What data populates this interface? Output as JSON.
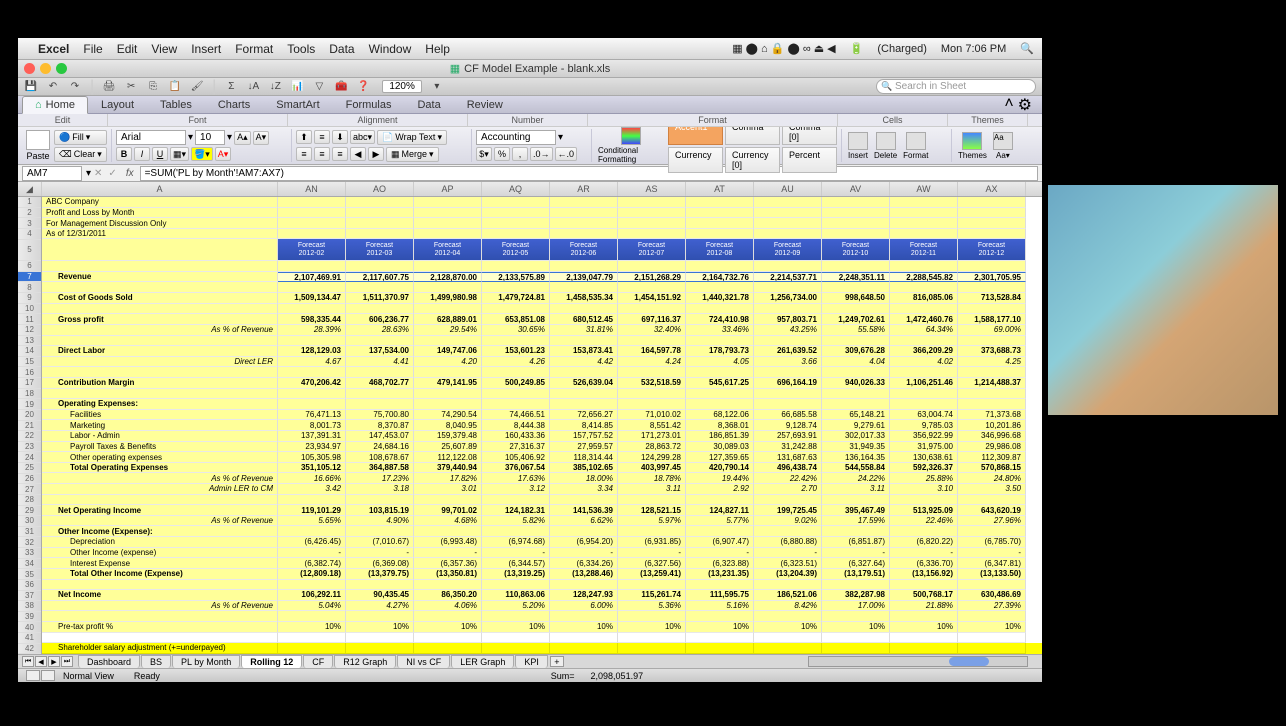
{
  "menubar": {
    "app": "Excel",
    "items": [
      "File",
      "Edit",
      "View",
      "Insert",
      "Format",
      "Tools",
      "Data",
      "Window",
      "Help"
    ],
    "battery": "(Charged)",
    "clock": "Mon 7:06 PM"
  },
  "window": {
    "title": "CF Model Example - blank.xls"
  },
  "qat": {
    "zoom": "120%",
    "search_placeholder": "Search in Sheet"
  },
  "ribbon": {
    "tabs": [
      "Home",
      "Layout",
      "Tables",
      "Charts",
      "SmartArt",
      "Formulas",
      "Data",
      "Review"
    ],
    "groups": {
      "edit": "Edit",
      "font": "Font",
      "align": "Alignment",
      "number": "Number",
      "format": "Format",
      "cells": "Cells",
      "themes": "Themes"
    },
    "fill": "Fill",
    "clear": "Clear",
    "paste": "Paste",
    "font_name": "Arial",
    "font_size": "10",
    "wrap": "Wrap Text",
    "merge": "Merge",
    "num_format": "Accounting",
    "cond_fmt": "Conditional Formatting",
    "styles": {
      "accent": "Accent1",
      "comma": "Comma",
      "comma0": "Comma [0]",
      "currency": "Currency",
      "currency0": "Currency [0]",
      "percent": "Percent"
    },
    "insert": "Insert",
    "delete": "Delete",
    "format_btn": "Format",
    "themes_btn": "Themes"
  },
  "formula": {
    "name_box": "AM7",
    "formula": "=SUM('PL by Month'!AM7:AX7)"
  },
  "columns": [
    "A",
    "AN",
    "AO",
    "AP",
    "AQ",
    "AR",
    "AS",
    "AT",
    "AU",
    "AV",
    "AW",
    "AX"
  ],
  "header_top": "Forecast",
  "header_dates": [
    "2012-02",
    "2012-03",
    "2012-04",
    "2012-05",
    "2012-06",
    "2012-07",
    "2012-08",
    "2012-09",
    "2012-10",
    "2012-11",
    "2012-12"
  ],
  "row_labels": {
    "1": "ABC Company",
    "2": "Profit and Loss by Month",
    "3": "For Management Discussion Only",
    "4": "As of 12/31/2011",
    "7": "Revenue",
    "9": "Cost of Goods Sold",
    "11": "Gross profit",
    "12": "As % of Revenue",
    "14": "Direct Labor",
    "15": "Direct LER",
    "17": "Contribution Margin",
    "19": "Operating Expenses:",
    "20": "Facilities",
    "21": "Marketing",
    "22": "Labor - Admin",
    "23": "Payroll Taxes & Benefits",
    "24": "Other operating expenses",
    "25": "Total Operating Expenses",
    "26": "As % of Revenue",
    "27": "Admin LER to CM",
    "29": "Net Operating Income",
    "30": "As % of Revenue",
    "31": "Other Income (Expense):",
    "32": "Depreciation",
    "33": "Other Income (expense)",
    "34": "Interest Expense",
    "35": "Total Other Income (Expense)",
    "37": "Net Income",
    "38": "As % of Revenue",
    "40": "Pre-tax profit %",
    "42": "Shareholder salary adjustment (+=underpayed)"
  },
  "chart_data": {
    "type": "table",
    "rows": {
      "7": [
        "2,107,469.91",
        "2,117,607.75",
        "2,128,870.00",
        "2,133,575.89",
        "2,139,047.79",
        "2,151,268.29",
        "2,164,732.76",
        "2,214,537.71",
        "2,248,351.11",
        "2,288,545.82",
        "2,301,705.95"
      ],
      "9": [
        "1,509,134.47",
        "1,511,370.97",
        "1,499,980.98",
        "1,479,724.81",
        "1,458,535.34",
        "1,454,151.92",
        "1,440,321.78",
        "1,256,734.00",
        "998,648.50",
        "816,085.06",
        "713,528.84"
      ],
      "11": [
        "598,335.44",
        "606,236.77",
        "628,889.01",
        "653,851.08",
        "680,512.45",
        "697,116.37",
        "724,410.98",
        "957,803.71",
        "1,249,702.61",
        "1,472,460.76",
        "1,588,177.10"
      ],
      "12": [
        "28.39%",
        "28.63%",
        "29.54%",
        "30.65%",
        "31.81%",
        "32.40%",
        "33.46%",
        "43.25%",
        "55.58%",
        "64.34%",
        "69.00%"
      ],
      "14": [
        "128,129.03",
        "137,534.00",
        "149,747.06",
        "153,601.23",
        "153,873.41",
        "164,597.78",
        "178,793.73",
        "261,639.52",
        "309,676.28",
        "366,209.29",
        "373,688.73"
      ],
      "15": [
        "4.67",
        "4.41",
        "4.20",
        "4.26",
        "4.42",
        "4.24",
        "4.05",
        "3.66",
        "4.04",
        "4.02",
        "4.25"
      ],
      "17": [
        "470,206.42",
        "468,702.77",
        "479,141.95",
        "500,249.85",
        "526,639.04",
        "532,518.59",
        "545,617.25",
        "696,164.19",
        "940,026.33",
        "1,106,251.46",
        "1,214,488.37"
      ],
      "20": [
        "76,471.13",
        "75,700.80",
        "74,290.54",
        "74,466.51",
        "72,656.27",
        "71,010.02",
        "68,122.06",
        "66,685.58",
        "65,148.21",
        "63,004.74",
        "71,373.68"
      ],
      "21": [
        "8,001.73",
        "8,370.87",
        "8,040.95",
        "8,444.38",
        "8,414.85",
        "8,551.42",
        "8,368.01",
        "9,128.74",
        "9,279.61",
        "9,785.03",
        "10,201.86"
      ],
      "22": [
        "137,391.31",
        "147,453.07",
        "159,379.48",
        "160,433.36",
        "157,757.52",
        "171,273.01",
        "186,851.39",
        "257,693.91",
        "302,017.33",
        "356,922.99",
        "346,996.68"
      ],
      "23": [
        "23,934.97",
        "24,684.16",
        "25,607.89",
        "27,316.37",
        "27,959.57",
        "28,863.72",
        "30,089.03",
        "31,242.88",
        "31,949.35",
        "31,975.00",
        "29,986.08"
      ],
      "24": [
        "105,305.98",
        "108,678.67",
        "112,122.08",
        "105,406.92",
        "118,314.44",
        "124,299.28",
        "127,359.65",
        "131,687.63",
        "136,164.35",
        "130,638.61",
        "112,309.87"
      ],
      "25": [
        "351,105.12",
        "364,887.58",
        "379,440.94",
        "376,067.54",
        "385,102.65",
        "403,997.45",
        "420,790.14",
        "496,438.74",
        "544,558.84",
        "592,326.37",
        "570,868.15"
      ],
      "26": [
        "16.66%",
        "17.23%",
        "17.82%",
        "17.63%",
        "18.00%",
        "18.78%",
        "19.44%",
        "22.42%",
        "24.22%",
        "25.88%",
        "24.80%"
      ],
      "27": [
        "3.42",
        "3.18",
        "3.01",
        "3.12",
        "3.34",
        "3.11",
        "2.92",
        "2.70",
        "3.11",
        "3.10",
        "3.50"
      ],
      "29": [
        "119,101.29",
        "103,815.19",
        "99,701.02",
        "124,182.31",
        "141,536.39",
        "128,521.15",
        "124,827.11",
        "199,725.45",
        "395,467.49",
        "513,925.09",
        "643,620.19"
      ],
      "30": [
        "5.65%",
        "4.90%",
        "4.68%",
        "5.82%",
        "6.62%",
        "5.97%",
        "5.77%",
        "9.02%",
        "17.59%",
        "22.46%",
        "27.96%"
      ],
      "32": [
        "(6,426.45)",
        "(7,010.67)",
        "(6,993.48)",
        "(6,974.68)",
        "(6,954.20)",
        "(6,931.85)",
        "(6,907.47)",
        "(6,880.88)",
        "(6,851.87)",
        "(6,820.22)",
        "(6,785.70)"
      ],
      "33": [
        "-",
        "-",
        "-",
        "-",
        "-",
        "-",
        "-",
        "-",
        "-",
        "-",
        "-"
      ],
      "34": [
        "(6,382.74)",
        "(6,369.08)",
        "(6,357.36)",
        "(6,344.57)",
        "(6,334.26)",
        "(6,327.56)",
        "(6,323.88)",
        "(6,323.51)",
        "(6,327.64)",
        "(6,336.70)",
        "(6,347.81)"
      ],
      "35": [
        "(12,809.18)",
        "(13,379.75)",
        "(13,350.81)",
        "(13,319.25)",
        "(13,288.46)",
        "(13,259.41)",
        "(13,231.35)",
        "(13,204.39)",
        "(13,179.51)",
        "(13,156.92)",
        "(13,133.50)"
      ],
      "37": [
        "106,292.11",
        "90,435.45",
        "86,350.20",
        "110,863.06",
        "128,247.93",
        "115,261.74",
        "111,595.75",
        "186,521.06",
        "382,287.98",
        "500,768.17",
        "630,486.69"
      ],
      "38": [
        "5.04%",
        "4.27%",
        "4.06%",
        "5.20%",
        "6.00%",
        "5.36%",
        "5.16%",
        "8.42%",
        "17.00%",
        "21.88%",
        "27.39%"
      ],
      "40": [
        "10%",
        "10%",
        "10%",
        "10%",
        "10%",
        "10%",
        "10%",
        "10%",
        "10%",
        "10%",
        "10%"
      ]
    }
  },
  "sheet_tabs": [
    "Dashboard",
    "BS",
    "PL by Month",
    "Rolling 12",
    "CF",
    "R12 Graph",
    "NI vs CF",
    "LER Graph",
    "KPI"
  ],
  "status": {
    "view": "Normal View",
    "ready": "Ready",
    "sum": "Sum=",
    "sum_val": "2,098,051.97"
  }
}
